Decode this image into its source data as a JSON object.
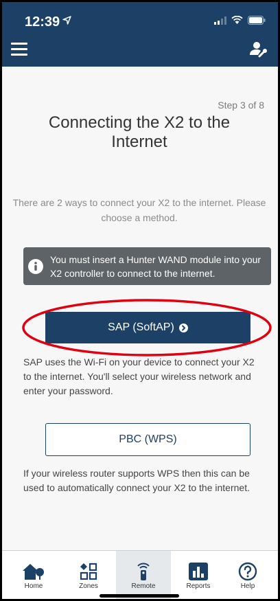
{
  "status_bar": {
    "time": "12:39",
    "location_icon": "location-arrow-icon",
    "signal_icon": "cellular-signal-icon",
    "wifi_icon": "wifi-icon",
    "battery_icon": "battery-icon"
  },
  "nav": {
    "menu_icon": "hamburger-menu-icon",
    "settings_icon": "user-wrench-icon"
  },
  "content": {
    "step": "Step 3 of 8",
    "title": "Connecting the X2 to the Internet",
    "intro": "There are 2 ways to connect your X2 to the internet. Please choose a method.",
    "alert": "You must insert a Hunter WAND module into your X2 controller to connect to the internet.",
    "sap_button": "SAP (SoftAP)",
    "sap_description": "SAP uses the Wi-Fi on your device to connect your X2 to the internet. You'll select your wireless network and enter your password.",
    "wps_button": "PBC (WPS)",
    "wps_description": "If your wireless router supports WPS then this can be used to automatically connect your X2 to the internet."
  },
  "tabs": [
    {
      "label": "Home",
      "icon": "home-icon"
    },
    {
      "label": "Zones",
      "icon": "zones-grid-icon"
    },
    {
      "label": "Remote",
      "icon": "remote-icon",
      "active": true
    },
    {
      "label": "Reports",
      "icon": "reports-chart-icon"
    },
    {
      "label": "Help",
      "icon": "help-icon"
    }
  ],
  "colors": {
    "primary": "#1d4066",
    "alert_bg": "#5d6367",
    "highlight": "#e0000f",
    "background": "#f7f7f7"
  }
}
